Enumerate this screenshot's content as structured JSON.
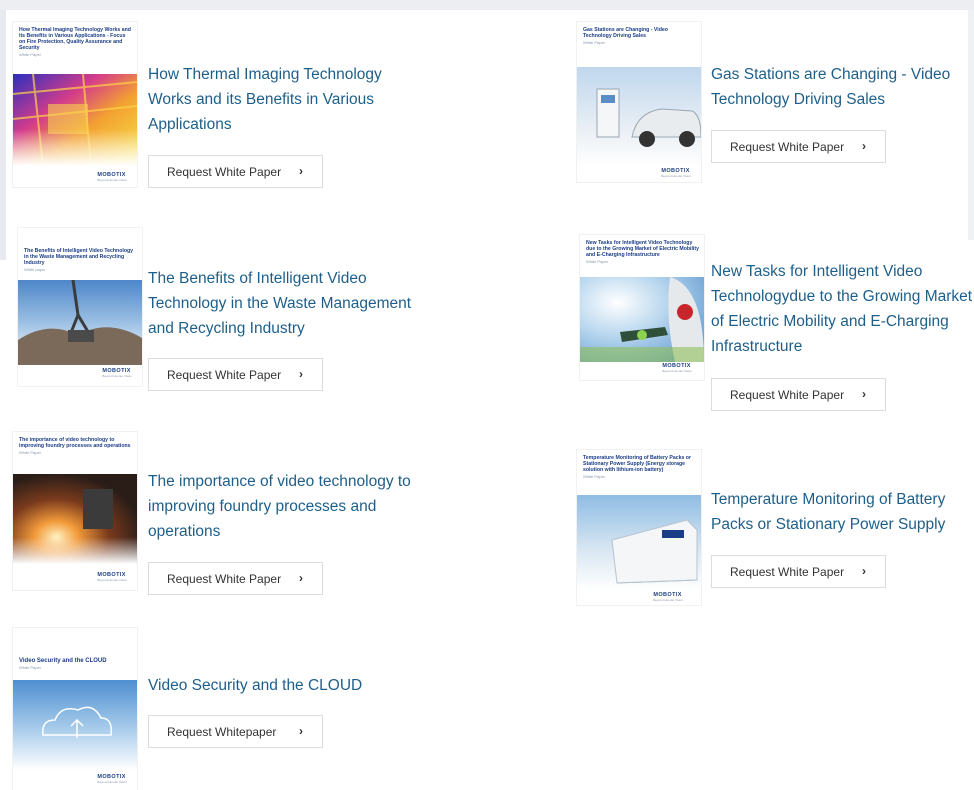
{
  "papers": [
    {
      "thumb_title": "How Thermal Imaging Technology Works and its Benefits in Various Applications - Focus on Fire Protection, Quality Assurance and Security",
      "thumb_sub": "White Paper",
      "logo": "MOBOTIX",
      "title_lines": [
        "How Thermal Imaging Technology",
        "Works and its Benefits in Various",
        "Applications"
      ],
      "button": "Request White Paper"
    },
    {
      "thumb_title": "Gas Stations are Changing - Video Technology Driving Sales",
      "thumb_sub": "White Paper",
      "logo": "MOBOTIX",
      "title_lines": [
        "Gas Stations are Changing - Video",
        "Technology Driving Sales"
      ],
      "button": "Request White Paper"
    },
    {
      "thumb_title": "The Benefits of Intelligent Video Technology in the Waste Management and Recycling Industry",
      "thumb_sub": "White paper",
      "logo": "MOBOTIX",
      "title_lines": [
        "The Benefits of Intelligent Video",
        "Technology in the Waste Management",
        "and Recycling Industry"
      ],
      "button": "Request White Paper"
    },
    {
      "thumb_title": "New Tasks for Intelligent Video Technology due to the Growing Market of Electric Mobility and E-Charging Infrastructure",
      "thumb_sub": "White Paper",
      "logo": "MOBOTIX",
      "title_lines": [
        "New Tasks for Intelligent Video",
        "Technologydue to the Growing Market",
        "of Electric Mobility and E-Charging",
        "Infrastructure"
      ],
      "button": "Request White Paper"
    },
    {
      "thumb_title": "The importance of video technology to improving foundry processes and operations",
      "thumb_sub": "White Paper",
      "logo": "MOBOTIX",
      "title_lines": [
        "The importance of video technology to",
        "improving foundry processes and",
        "operations"
      ],
      "button": "Request White Paper"
    },
    {
      "thumb_title": "Temperature Monitoring of Battery Packs or Stationary Power Supply (Energy storage solution with lithium-ion battery)",
      "thumb_sub": "White Paper",
      "logo": "MOBOTIX",
      "title_lines": [
        "Temperature Monitoring of Battery",
        "Packs or Stationary Power Supply"
      ],
      "button": "Request White Paper"
    },
    {
      "thumb_title": "Video Security and the CLOUD",
      "thumb_sub": "White Paper",
      "logo": "MOBOTIX",
      "title_lines": [
        "Video Security and the CLOUD"
      ],
      "button": "Request Whitepaper"
    }
  ],
  "colors": {
    "link": "#1e5f8a",
    "thumb_title": "#1b3d86",
    "button_border": "#dcdcdc"
  },
  "icons": {
    "button": "chevron-right-icon"
  }
}
